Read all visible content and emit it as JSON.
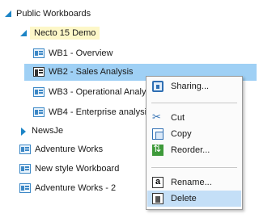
{
  "tree": {
    "root": "Public Workboards",
    "folder": "Necto 15 Demo",
    "items": [
      "WB1 - Overview",
      "WB2 - Sales Analysis",
      "WB3 - Operational Analy",
      "WB4 - Enterprise analysi"
    ],
    "folder2": "NewsJe",
    "others": [
      "Adventure Works",
      "New style  Workboard",
      "Adventure Works - 2"
    ]
  },
  "context_menu": {
    "sharing": "Sharing...",
    "cut": "Cut",
    "copy": "Copy",
    "reorder": "Reorder...",
    "rename": "Rename...",
    "delete": "Delete"
  }
}
